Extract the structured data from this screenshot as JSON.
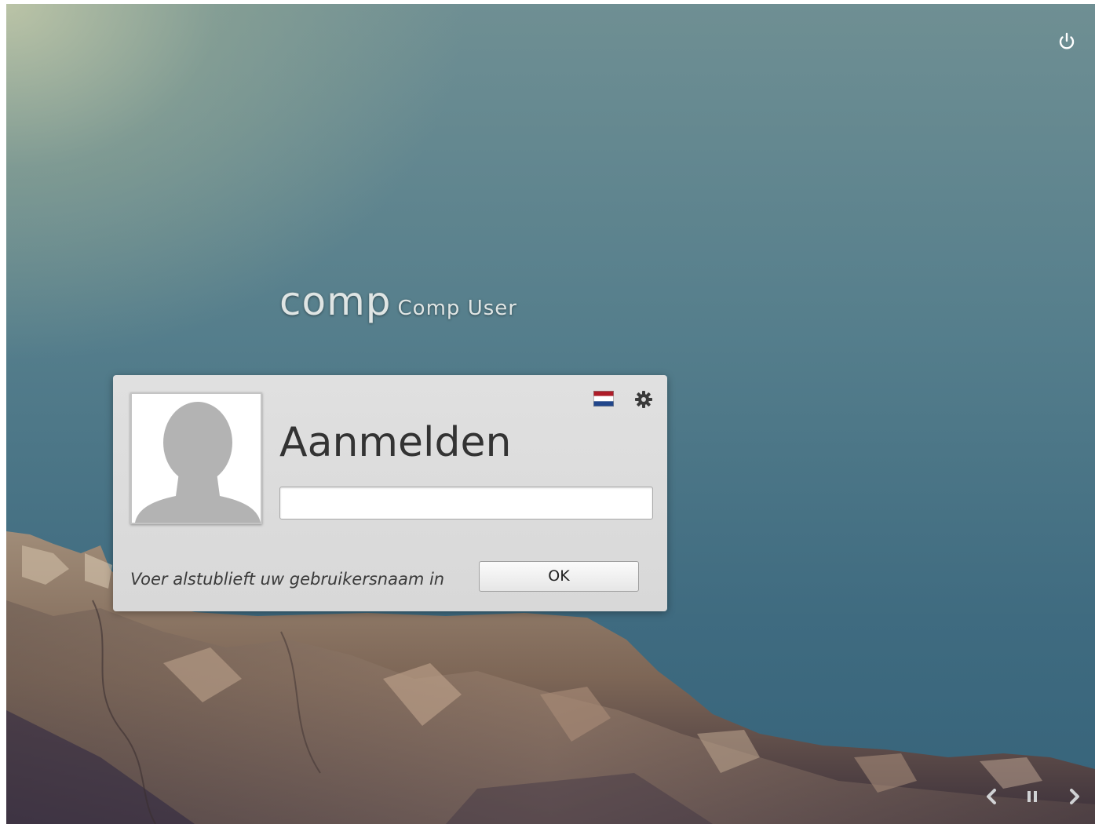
{
  "greeter": {
    "hostname": "comp",
    "fullname": "Comp User"
  },
  "login_box": {
    "title": "Aanmelden",
    "username_value": "",
    "prompt": "Voer alstublieft uw gebruikersnaam in",
    "ok_label": "OK",
    "language_icon": "netherlands-flag-icon",
    "settings_icon": "gear-icon"
  },
  "top_bar": {
    "power_icon": "power-icon"
  },
  "slideshow": {
    "prev_icon": "chevron-left-icon",
    "pause_icon": "pause-icon",
    "next_icon": "chevron-right-icon"
  },
  "colors": {
    "flag_red": "#ae1c28",
    "flag_white": "#ffffff",
    "flag_blue": "#21468b",
    "panel_bg": "#dadada"
  }
}
